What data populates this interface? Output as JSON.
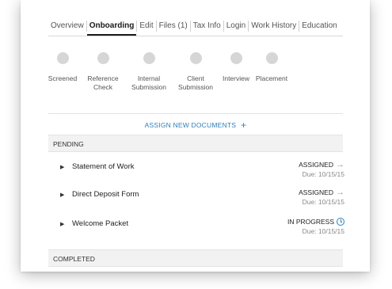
{
  "tabs": [
    {
      "label": "Overview",
      "active": false
    },
    {
      "label": "Onboarding",
      "active": true
    },
    {
      "label": "Edit",
      "active": false
    },
    {
      "label": "Files (1)",
      "active": false
    },
    {
      "label": "Tax Info",
      "active": false
    },
    {
      "label": "Login",
      "active": false
    },
    {
      "label": "Work History",
      "active": false
    },
    {
      "label": "Education",
      "active": false
    }
  ],
  "steps": [
    {
      "label": "Screened"
    },
    {
      "label": "Reference\nCheck"
    },
    {
      "label": "Internal\nSubmission"
    },
    {
      "label": "Client\nSubmission"
    },
    {
      "label": "Interview"
    },
    {
      "label": "Placement"
    }
  ],
  "assign": {
    "label": "ASSIGN NEW DOCUMENTS",
    "icon": "plus-icon"
  },
  "pending": {
    "heading": "PENDING",
    "documents": [
      {
        "name": "Statement of Work",
        "status": "ASSIGNED",
        "status_icon": "arrow-right-icon",
        "due": "Due: 10/15/15"
      },
      {
        "name": "Direct Deposit Form",
        "status": "ASSIGNED",
        "status_icon": "arrow-right-icon",
        "due": "Due: 10/15/15"
      },
      {
        "name": "Welcome Packet",
        "status": "IN PROGRESS",
        "status_icon": "clock-icon",
        "due": "Due: 10/15/15"
      }
    ]
  },
  "completed": {
    "heading": "COMPLETED"
  },
  "colors": {
    "accent": "#2d7fc1",
    "step_dot": "#d6d6d6",
    "section_bg": "#f2f2f2"
  }
}
